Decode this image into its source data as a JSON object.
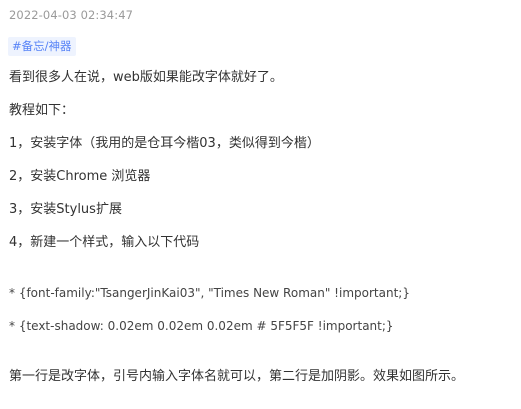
{
  "memo": {
    "timestamp": "2022-04-03 02:34:47",
    "tag": "#备忘/神器",
    "lines": [
      "看到很多人在说，web版如果能改字体就好了。",
      "教程如下：",
      "1，安装字体（我用的是仓耳今楷03，类似得到今楷）",
      "2，安装Chrome 浏览器",
      "3，安装Stylus扩展",
      "4，新建一个样式，输入以下代码",
      "* {font-family:\"TsangerJinKai03\", \"Times New Roman\" !important;}",
      "* {text-shadow: 0.02em 0.02em 0.02em # 5F5F5F !important;}",
      "第一行是改字体，引号内输入字体名就可以，第二行是加阴影。效果如图所示。"
    ]
  },
  "colors": {
    "timestamp": "#9a9a9a",
    "tag_text": "#5783f7",
    "tag_background": "#eef3fe",
    "body_text": "#323232"
  }
}
